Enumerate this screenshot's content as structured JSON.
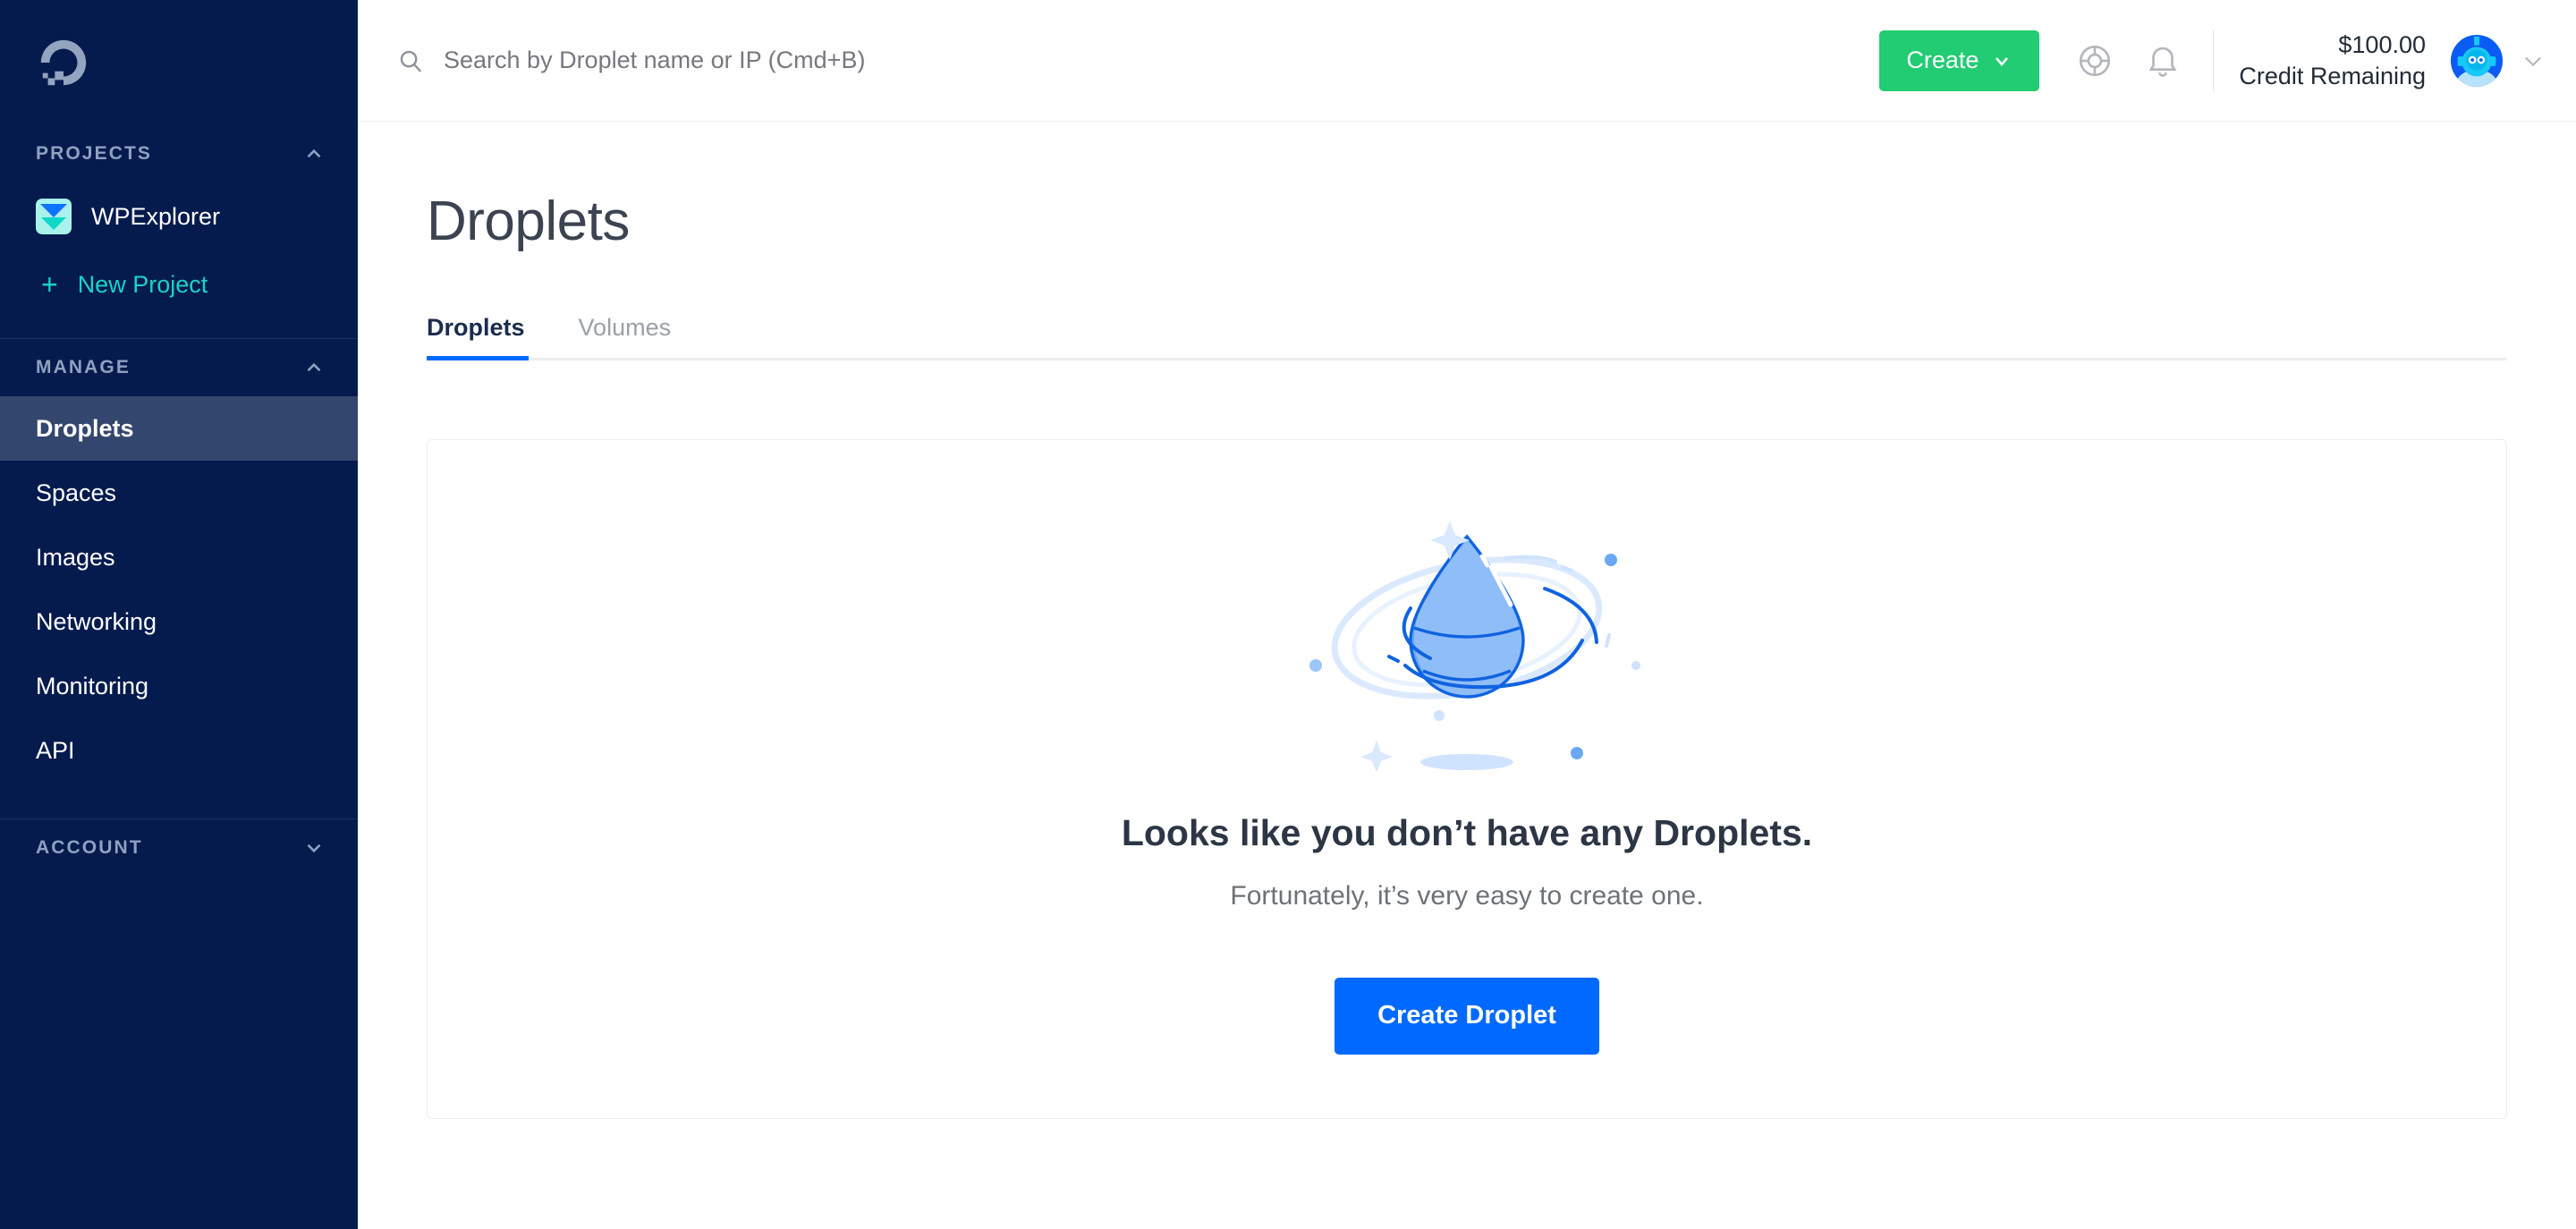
{
  "sidebar": {
    "logo": "digitalocean-logo",
    "sections": [
      {
        "title": "PROJECTS",
        "collapse_icon": "chevron-up-icon"
      },
      {
        "title": "MANAGE",
        "collapse_icon": "chevron-up-icon"
      },
      {
        "title": "ACCOUNT",
        "collapse_icon": "chevron-down-icon"
      }
    ],
    "project": {
      "name": "WPExplorer",
      "icon": "wpexplorer-icon"
    },
    "new_project": {
      "label": "New Project",
      "icon": "plus-icon"
    },
    "manage_items": [
      {
        "label": "Droplets",
        "active": true
      },
      {
        "label": "Spaces",
        "active": false
      },
      {
        "label": "Images",
        "active": false
      },
      {
        "label": "Networking",
        "active": false
      },
      {
        "label": "Monitoring",
        "active": false
      },
      {
        "label": "API",
        "active": false
      }
    ]
  },
  "header": {
    "search": {
      "placeholder": "Search by Droplet name or IP (Cmd+B)",
      "value": "",
      "icon": "search-icon"
    },
    "create_button": {
      "label": "Create",
      "icon": "chevron-down-icon",
      "color": "#21cc72"
    },
    "support_icon": "lifesaver-icon",
    "notifications_icon": "bell-icon",
    "credit": {
      "amount": "$100.00",
      "label": "Credit Remaining"
    },
    "avatar": {
      "icon": "robot-avatar",
      "menu_icon": "chevron-down-icon"
    }
  },
  "main": {
    "page_title": "Droplets",
    "tabs": [
      {
        "label": "Droplets",
        "active": true
      },
      {
        "label": "Volumes",
        "active": false
      }
    ],
    "empty_state": {
      "illustration": "droplet-orbit-illustration",
      "title": "Looks like you don’t have any Droplets.",
      "subtitle": "Fortunately, it’s very easy to create one.",
      "button_label": "Create Droplet"
    }
  },
  "colors": {
    "sidebar_bg": "#051b4e",
    "sidebar_active": "#33466e",
    "accent_blue": "#0069ff",
    "accent_green": "#21cc72",
    "accent_teal": "#19d3c5"
  }
}
